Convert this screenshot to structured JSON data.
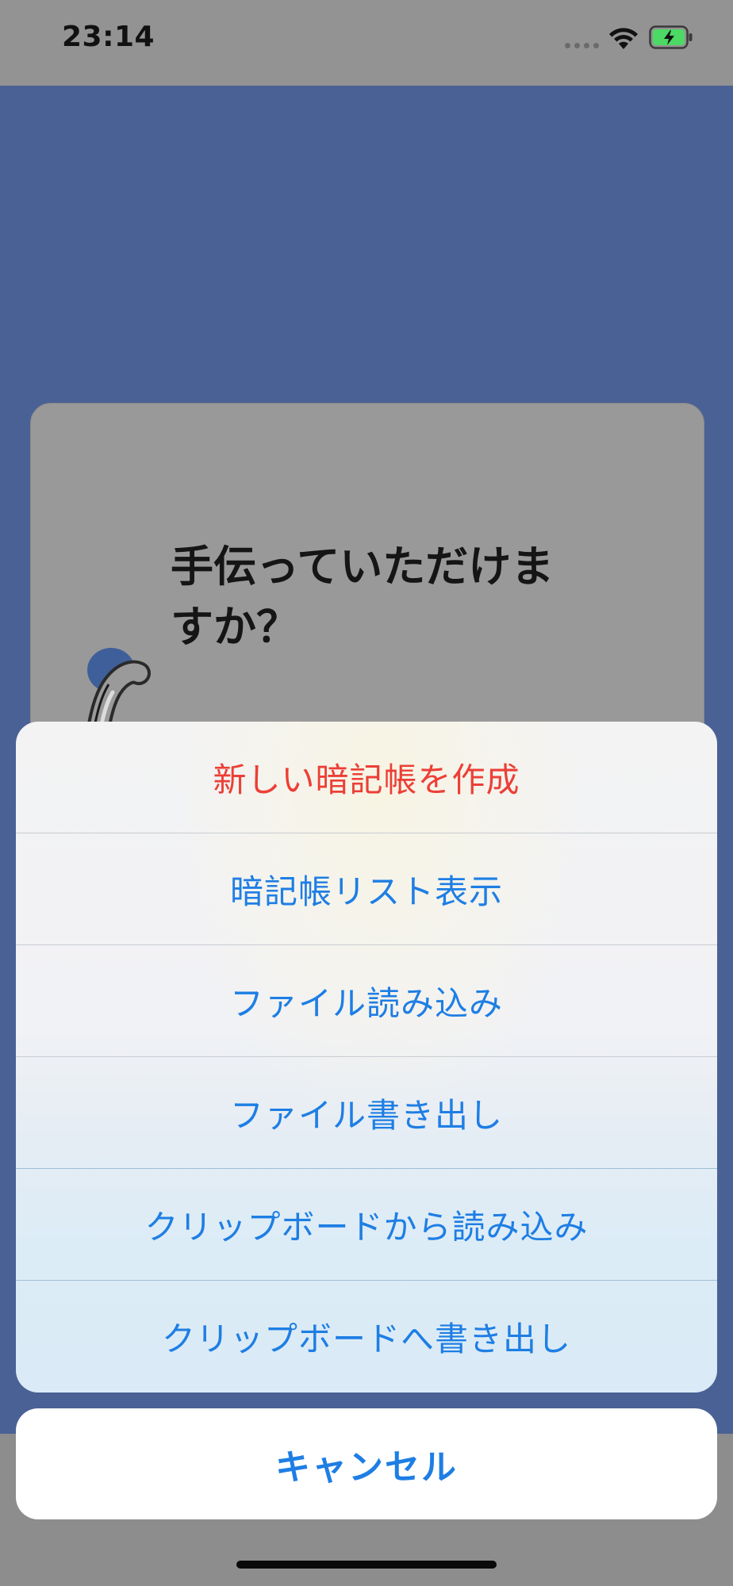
{
  "status_bar": {
    "time": "23:14",
    "wifi_icon": "wifi-icon",
    "battery_icon": "battery-charging-icon",
    "battery_color": "#4cd964"
  },
  "card": {
    "text": "手伝っていただけますか？",
    "ring_icon": "binder-ring-icon"
  },
  "action_sheet": {
    "items": [
      {
        "label": "新しい暗記帳を作成",
        "style": "destructive"
      },
      {
        "label": "暗記帳リスト表示",
        "style": "default"
      },
      {
        "label": "ファイル読み込み",
        "style": "default"
      },
      {
        "label": "ファイル書き出し",
        "style": "default"
      },
      {
        "label": "クリップボードから読み込み",
        "style": "default"
      },
      {
        "label": "クリップボードへ書き出し",
        "style": "default"
      }
    ],
    "cancel_label": "キャンセル"
  },
  "colors": {
    "accent": "#1e7ee4",
    "destructive": "#ec3f36",
    "background": "#4a6195"
  }
}
